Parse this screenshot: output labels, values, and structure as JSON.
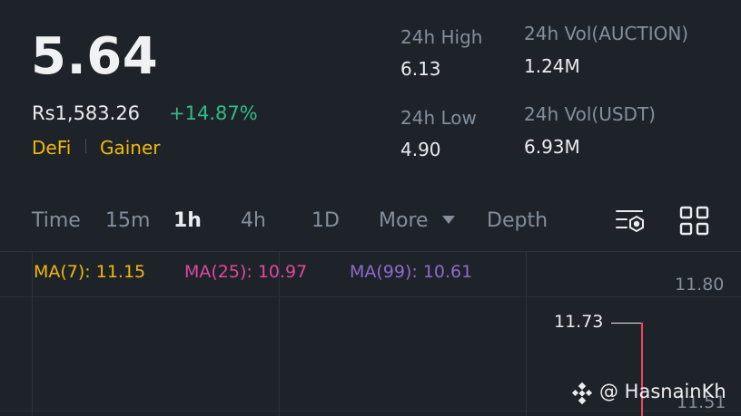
{
  "ticker": {
    "last_price": "5.64",
    "fiat_price": "Rs1,583.26",
    "change_pct": "+14.87%",
    "tags": [
      "DeFi",
      "Gainer"
    ]
  },
  "stats": {
    "high": {
      "label": "24h High",
      "value": "6.13"
    },
    "low": {
      "label": "24h Low",
      "value": "4.90"
    },
    "vol_base": {
      "label": "24h Vol(AUCTION)",
      "value": "1.24M"
    },
    "vol_quote": {
      "label": "24h Vol(USDT)",
      "value": "6.93M"
    }
  },
  "chart_tabs": {
    "time": "Time",
    "m15": "15m",
    "h1": "1h",
    "h4": "4h",
    "d1": "1D",
    "more": "More",
    "depth": "Depth",
    "active": "1h"
  },
  "icons": {
    "indicator_settings": "indicator-settings-icon",
    "layout_grid": "grid-layout-icon",
    "more_caret": "caret-down-icon",
    "watermark_logo": "binance-logo-icon"
  },
  "ma": {
    "ma7": "MA(7): 11.15",
    "ma25": "MA(25): 10.97",
    "ma99": "MA(99): 10.61"
  },
  "price_axis": {
    "top": "11.80",
    "bottom": "11.51"
  },
  "chart_marker": {
    "high_label": "11.73"
  },
  "watermark": {
    "text": "@ HasnainKh"
  },
  "colors": {
    "background": "#1e2329",
    "up": "#2ebd85",
    "down": "#f6465d",
    "accent": "#f0b90b",
    "ma7": "#f0b90b",
    "ma25": "#e0479e",
    "ma99": "#8f6acb"
  }
}
